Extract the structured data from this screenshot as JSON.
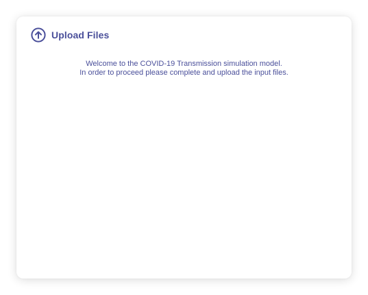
{
  "card": {
    "title": "Upload Files",
    "icon": "upload-circle-arrow-icon",
    "intro_line_1": "Welcome to the COVID-19 Transmission simulation model.",
    "intro_line_2": "In order to proceed please complete and upload the input files."
  },
  "colors": {
    "accent": "#4a4f9a",
    "background": "#ffffff"
  }
}
